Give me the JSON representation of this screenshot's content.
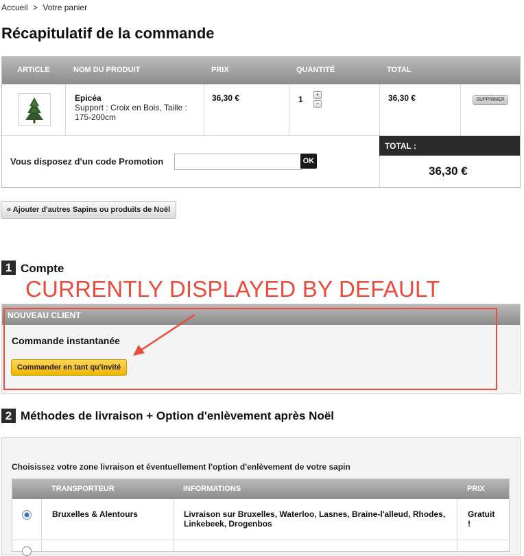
{
  "breadcrumb": {
    "home": "Accueil",
    "separator": ">",
    "current": "Votre panier"
  },
  "page_title": "Récapitulatif de la commande",
  "cart": {
    "headers": [
      "ARTICLE",
      "NOM DU PRODUIT",
      "PRIX",
      "QUANTITÉ",
      "TOTAL"
    ],
    "item": {
      "name": "Epicéa",
      "details": "Support : Croix en Bois, Taille : 175-200cm",
      "price": "36,30 €",
      "quantity": "1",
      "increment": "+",
      "decrement": "−",
      "total": "36,30 €",
      "remove_label": "SUPPRIMER"
    },
    "promo_label": "Vous disposez d'un code Promotion",
    "promo_value": "",
    "promo_ok": "OK",
    "total_label": "TOTAL :",
    "total_value": "36,30 €"
  },
  "add_more_label": "« Ajouter d'autres Sapins ou produits de Noël",
  "annotation": {
    "text": "CURRENTLY DISPLAYED BY DEFAULT",
    "color": "#ec4a3c"
  },
  "step1": {
    "number": "1",
    "title": "Compte",
    "panel_header": "NOUVEAU CLIENT",
    "subtitle": "Commande instantanée",
    "guest_button": "Commander en tant qu'invité"
  },
  "step2": {
    "number": "2",
    "title": "Méthodes de livraison + Option d'enlèvement après Noël",
    "instruction": "Choisissez votre zone livraison et éventuellement l'option d'enlèvement de votre sapin",
    "headers": [
      "TRANSPORTEUR",
      "INFORMATIONS",
      "PRIX"
    ],
    "rows": [
      {
        "selected": true,
        "carrier": "Bruxelles & Alentours",
        "info": "Livraison sur Bruxelles, Waterloo, Lasnes, Braine-l'alleud, Rhodes, Linkebeek, Drogenbos",
        "price": "Gratuit !"
      }
    ]
  },
  "colors": {
    "header_grey": "#9f9f9f",
    "dark": "#2b2b2b",
    "button_yellow": "#f7c31f",
    "annotation_red": "#ec4a3c"
  },
  "icons": [
    "tree-product-image",
    "radio-selected-icon",
    "annotation-arrow"
  ]
}
